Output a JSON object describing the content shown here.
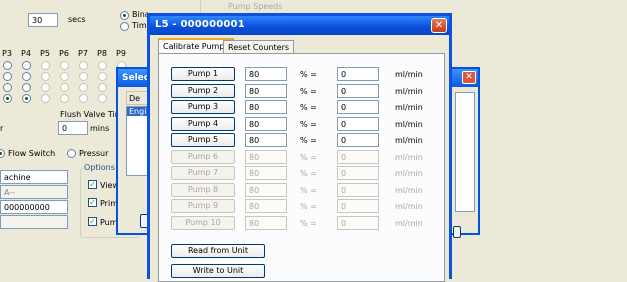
{
  "background": {
    "time_value": "30",
    "time_unit": "secs",
    "radio_top1": "Bina",
    "radio_top2": "Tim",
    "pump_headers": [
      "P3",
      "P4",
      "P5",
      "P6",
      "P7",
      "P8",
      "P9"
    ],
    "flush_label": "Flush Valve Time",
    "flush_left": "r",
    "flush_value": "0",
    "flush_unit": "mins",
    "flow_switch": "Flow Switch",
    "pressure": "Pressur",
    "options_group": "Options E",
    "machine_label": "achine",
    "machine_sub": "A--",
    "machine_serial": "000000000",
    "check_view": "View",
    "check_prime": "Prime",
    "check_pump": "Pump",
    "top_right_label": "Pump Speeds"
  },
  "select_dialog": {
    "title": "Selec",
    "desc_col": "De",
    "list_item": "Engi"
  },
  "dialog": {
    "title": "L5 - 000000001",
    "tabs": [
      "Calibrate Pumps",
      "Reset Counters"
    ],
    "active_tab": "Calibrate Pumps",
    "pct_label": "% =",
    "unit_label": "ml/min",
    "pumps": [
      {
        "label": "Pump 1",
        "pct": "80",
        "rate": "0",
        "enabled": true
      },
      {
        "label": "Pump 2",
        "pct": "80",
        "rate": "0",
        "enabled": true
      },
      {
        "label": "Pump 3",
        "pct": "80",
        "rate": "0",
        "enabled": true
      },
      {
        "label": "Pump 4",
        "pct": "80",
        "rate": "0",
        "enabled": true
      },
      {
        "label": "Pump 5",
        "pct": "80",
        "rate": "0",
        "enabled": true
      },
      {
        "label": "Pump 6",
        "pct": "80",
        "rate": "0",
        "enabled": false
      },
      {
        "label": "Pump 7",
        "pct": "80",
        "rate": "0",
        "enabled": false
      },
      {
        "label": "Pump 8",
        "pct": "80",
        "rate": "0",
        "enabled": false
      },
      {
        "label": "Pump 9",
        "pct": "80",
        "rate": "0",
        "enabled": false
      },
      {
        "label": "Pump 10",
        "pct": "80",
        "rate": "0",
        "enabled": false
      }
    ],
    "read_button": "Read from Unit",
    "write_button": "Write to Unit"
  }
}
